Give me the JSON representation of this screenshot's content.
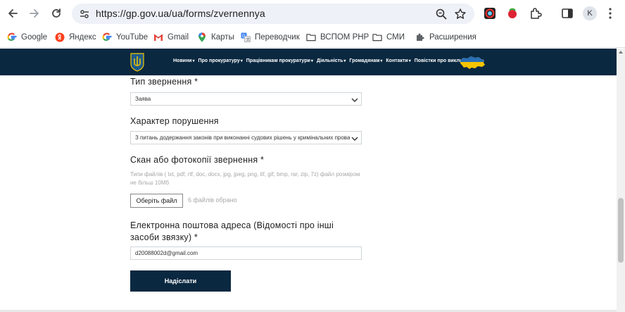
{
  "browser": {
    "url": "https://gp.gov.ua/ua/forms/zvernennya",
    "profile_initial": "K"
  },
  "bookmarks": [
    {
      "label": "Google",
      "icon": "google-icon"
    },
    {
      "label": "Яндекс",
      "icon": "yandex-icon"
    },
    {
      "label": "YouTube",
      "icon": "google-icon"
    },
    {
      "label": "Gmail",
      "icon": "gmail-icon"
    },
    {
      "label": "Карты",
      "icon": "maps-pin-icon"
    },
    {
      "label": "Переводчик",
      "icon": "translate-icon"
    },
    {
      "label": "ВСПОМ PHP",
      "icon": "folder-icon"
    },
    {
      "label": "СМИ",
      "icon": "folder-icon"
    },
    {
      "label": "Расширения",
      "icon": "puzzle-icon"
    }
  ],
  "site": {
    "menu": [
      {
        "label": "Новини"
      },
      {
        "label": "Про прокуратуру"
      },
      {
        "label": "Працівникам прокуратури"
      },
      {
        "label": "Діяльність"
      },
      {
        "label": "Громадянам"
      },
      {
        "label": "Контакти"
      },
      {
        "label": "Повістки про виклик"
      }
    ],
    "brand_color": "#0a2840"
  },
  "form": {
    "request_type": {
      "label": "Тип звернення *",
      "value": "Заява"
    },
    "violation": {
      "label": "Характер порушення",
      "value": "З питань додержання законів при виконанні судових рішень у кримінальних провадженнях"
    },
    "scan": {
      "label": "Скан або фотокопії звернення *",
      "hint": "Типи файлів ( txt, pdf, rtf, doc, docx, jpg, jpeg, png, tif, gif, bmp, rar, zip, 7z) файл розміром не більш 10Мб",
      "button": "Оберіть файл",
      "status": "6 файлів обрано"
    },
    "email": {
      "label": "Електронна поштова адреса (Відомості про інші засоби звязку) *",
      "value": "d20088002d@gmail.com"
    },
    "submit": "Надіслати"
  }
}
